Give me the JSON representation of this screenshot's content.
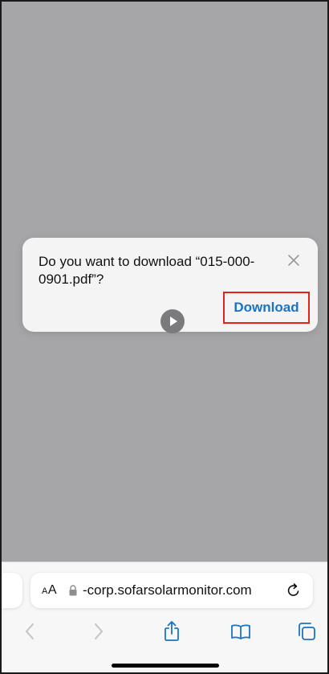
{
  "dialog": {
    "message": "Do you want to download “015-000-0901.pdf”?",
    "download_label": "Download"
  },
  "browser": {
    "aa_label_small": "A",
    "aa_label_large": "A",
    "url": "-corp.sofarsolarmonitor.com"
  },
  "icons": {
    "close": "close-icon",
    "play": "play-icon",
    "lock": "lock-icon",
    "reload": "reload-icon",
    "back": "chevron-left-icon",
    "forward": "chevron-right-icon",
    "share": "share-icon",
    "bookmarks": "book-icon",
    "tabs": "tabs-icon"
  },
  "colors": {
    "page_overlay": "#a6a6a8",
    "accent": "#1a73c9",
    "highlight_border": "#e2231a"
  }
}
